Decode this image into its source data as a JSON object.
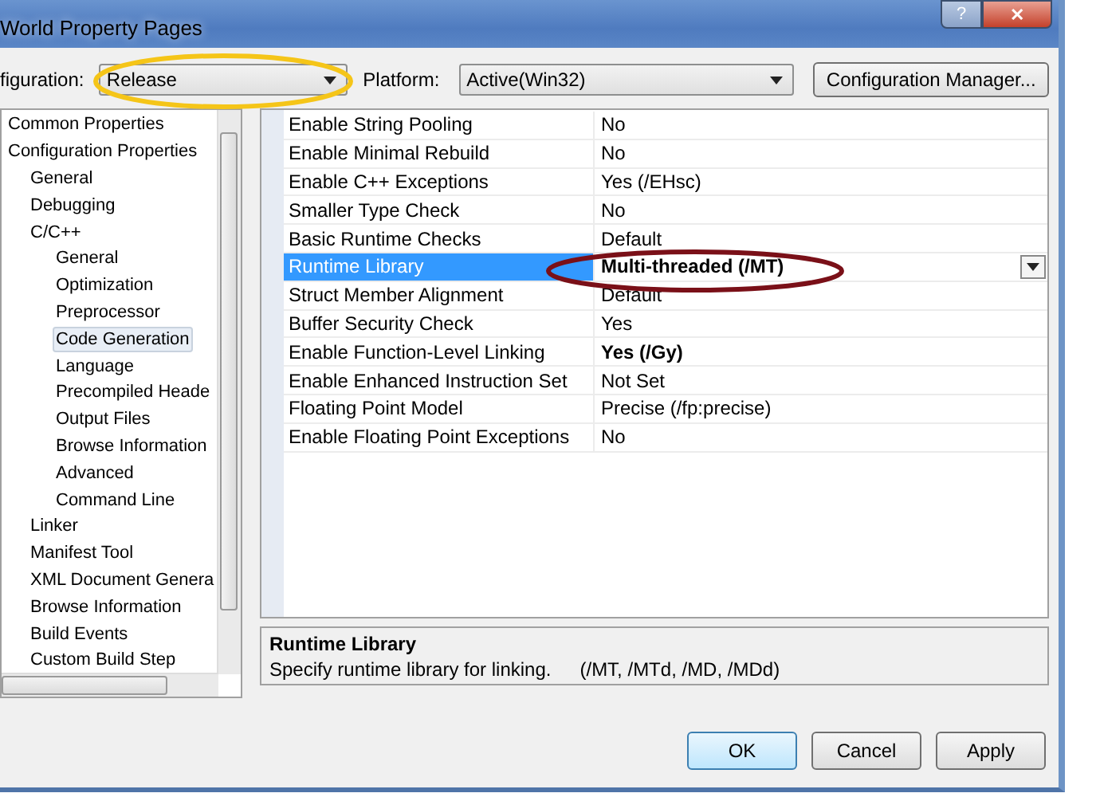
{
  "window": {
    "title": "World Property Pages",
    "help_button": "?",
    "close_button": "✕"
  },
  "configuration": {
    "label": "figuration:",
    "value": "Release"
  },
  "platform": {
    "label": "Platform:",
    "value": "Active(Win32)"
  },
  "configuration_manager_button": "Configuration Manager...",
  "tree": [
    {
      "label": "Common Properties",
      "selected": false
    },
    {
      "label": "Configuration Properties",
      "selected": false,
      "children": [
        {
          "label": "General",
          "selected": false
        },
        {
          "label": "Debugging",
          "selected": false
        },
        {
          "label": "C/C++",
          "selected": false,
          "children": [
            {
              "label": "General",
              "selected": false
            },
            {
              "label": "Optimization",
              "selected": false
            },
            {
              "label": "Preprocessor",
              "selected": false
            },
            {
              "label": "Code Generation",
              "selected": true
            },
            {
              "label": "Language",
              "selected": false
            },
            {
              "label": "Precompiled Heade",
              "selected": false
            },
            {
              "label": "Output Files",
              "selected": false
            },
            {
              "label": "Browse Information",
              "selected": false
            },
            {
              "label": "Advanced",
              "selected": false
            },
            {
              "label": "Command Line",
              "selected": false
            }
          ]
        },
        {
          "label": "Linker",
          "selected": false
        },
        {
          "label": "Manifest Tool",
          "selected": false
        },
        {
          "label": "XML Document Genera",
          "selected": false
        },
        {
          "label": "Browse Information",
          "selected": false
        },
        {
          "label": "Build Events",
          "selected": false
        },
        {
          "label": "Custom Build Step",
          "selected": false
        }
      ]
    }
  ],
  "properties": [
    {
      "name": "Enable String Pooling",
      "value": "No",
      "selected": false,
      "modified": false
    },
    {
      "name": "Enable Minimal Rebuild",
      "value": "No",
      "selected": false,
      "modified": false
    },
    {
      "name": "Enable C++ Exceptions",
      "value": "Yes (/EHsc)",
      "selected": false,
      "modified": false
    },
    {
      "name": "Smaller Type Check",
      "value": "No",
      "selected": false,
      "modified": false
    },
    {
      "name": "Basic Runtime Checks",
      "value": "Default",
      "selected": false,
      "modified": false
    },
    {
      "name": "Runtime Library",
      "value": "Multi-threaded (/MT)",
      "selected": true,
      "modified": true
    },
    {
      "name": "Struct Member Alignment",
      "value": "Default",
      "selected": false,
      "modified": false
    },
    {
      "name": "Buffer Security Check",
      "value": "Yes",
      "selected": false,
      "modified": false
    },
    {
      "name": "Enable Function-Level Linking",
      "value": "Yes (/Gy)",
      "selected": false,
      "modified": true
    },
    {
      "name": "Enable Enhanced Instruction Set",
      "value": "Not Set",
      "selected": false,
      "modified": false
    },
    {
      "name": "Floating Point Model",
      "value": "Precise (/fp:precise)",
      "selected": false,
      "modified": false
    },
    {
      "name": "Enable Floating Point Exceptions",
      "value": "No",
      "selected": false,
      "modified": false
    }
  ],
  "description": {
    "title": "Runtime Library",
    "text": "Specify runtime library for linking.",
    "switches": "(/MT, /MTd, /MD, /MDd)"
  },
  "buttons": [
    {
      "label": "OK",
      "default": true
    },
    {
      "label": "Cancel",
      "default": false
    },
    {
      "label": "Apply",
      "default": false
    }
  ],
  "annotations": [
    {
      "color": "#f5c518"
    },
    {
      "color": "#7a1018"
    }
  ]
}
